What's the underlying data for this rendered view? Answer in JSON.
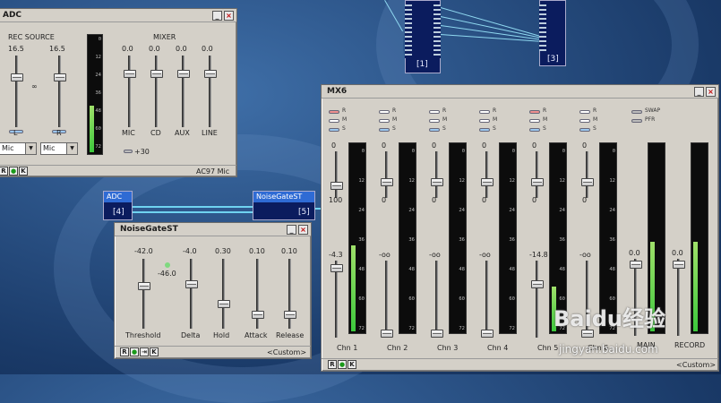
{
  "adc_window": {
    "title": "ADC",
    "rec_source_label": "REC SOURCE",
    "mixer_label": "MIXER",
    "l_value": "16.5",
    "r_value": "16.5",
    "l_label": "L",
    "r_label": "R",
    "link_label": "∞",
    "mixer_values": [
      "0.0",
      "0.0",
      "0.0",
      "0.0"
    ],
    "mixer_channels": [
      "MIC",
      "CD",
      "AUX",
      "LINE"
    ],
    "boost_label": "+30",
    "meter_ticks": [
      "0",
      "12",
      "24",
      "36",
      "48",
      "60",
      "72"
    ],
    "source_l": "Mic",
    "source_r": "Mic",
    "footer_label": "AC97 Mic",
    "bottom_buttons": [
      "R",
      "●",
      "K"
    ]
  },
  "nodes": {
    "adc_node_title": "ADC",
    "adc_node_index": "[4]",
    "noisegate_node_title": "NoiseGateST",
    "noisegate_node_index": "[5]",
    "top_node1_index": "[1]",
    "top_node2_index": "[3]"
  },
  "noisegate_window": {
    "title": "NoiseGateST",
    "values": [
      "-42.0",
      "-4.0",
      "0.30",
      "0.10",
      "0.10"
    ],
    "threshold_value2": "-46.0",
    "labels": [
      "Threshold",
      "Delta",
      "Hold",
      "Attack",
      "Release"
    ],
    "bottom_buttons": [
      "R",
      "●",
      "⇥",
      "K"
    ],
    "preset": "<Custom>"
  },
  "mx6_window": {
    "title": "MX6",
    "legend": [
      "R",
      "M",
      "S"
    ],
    "swap_label": "SWAP",
    "pfr_label": "PFR",
    "top_values": [
      "0",
      "0",
      "0",
      "0",
      "0",
      "0"
    ],
    "pan_values": [
      "100",
      "0",
      "0",
      "0",
      "0",
      "0"
    ],
    "gain_values": [
      "-4.3",
      "-oo",
      "-oo",
      "-oo",
      "-14.8",
      "-oo"
    ],
    "main_values": [
      "0.0",
      "0.0"
    ],
    "channels": [
      "Chn 1",
      "Chn 2",
      "Chn 3",
      "Chn 4",
      "Chn 5",
      "Chn 6"
    ],
    "main_labels": [
      "MAIN",
      "RECORD"
    ],
    "meter_ticks": [
      "0",
      "12",
      "24",
      "36",
      "48",
      "60",
      "72"
    ],
    "bottom_buttons": [
      "R",
      "●",
      "K"
    ],
    "preset": "<Custom>"
  },
  "watermark": {
    "text": "Baidu经验",
    "url": "jingyan.baidu.com"
  },
  "colors": {
    "desktop": "#2c5488",
    "window": "#d4d0c8",
    "node": "#0b1c5e",
    "wire": "#6fd3f0",
    "meter_green": "#3cc83c"
  }
}
